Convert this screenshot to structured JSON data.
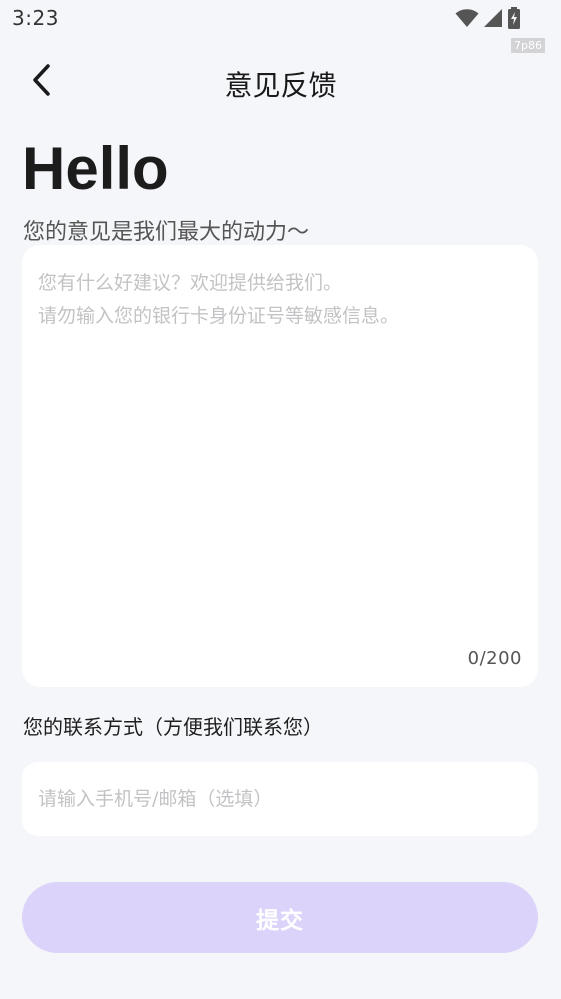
{
  "status_bar": {
    "time": "3:23",
    "icons": [
      "wifi-icon",
      "cellular-signal-icon",
      "battery-charging-icon"
    ],
    "badge": "7p86"
  },
  "nav": {
    "title": "意见反馈",
    "back_icon": "chevron-left-icon"
  },
  "header": {
    "greeting": "Hello",
    "subtitle": "您的意见是我们最大的动力～"
  },
  "feedback": {
    "value": "",
    "placeholder": "您有什么好建议？欢迎提供给我们。\n请勿输入您的银行卡身份证号等敏感信息。",
    "char_count": "0/200"
  },
  "contact": {
    "label": "您的联系方式（方便我们联系您）",
    "value": "",
    "placeholder": "请输入手机号/邮箱（选填）"
  },
  "submit": {
    "label": "提交"
  },
  "colors": {
    "background": "#f5f6fa",
    "card": "#ffffff",
    "submit_disabled": "#dcd3fa",
    "placeholder": "#c3c3c6"
  }
}
